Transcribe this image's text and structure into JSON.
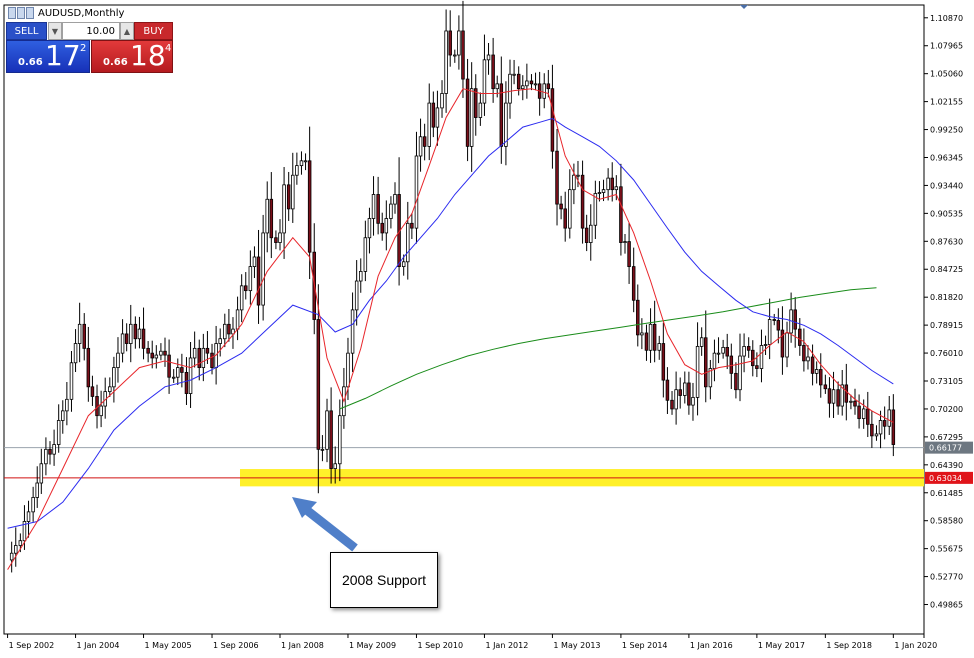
{
  "window": {
    "title": "AUDUSD,Monthly"
  },
  "trade_panel": {
    "sell_label": "SELL",
    "buy_label": "BUY",
    "lot_value": "10.00",
    "sell_price": {
      "prefix": "0.66",
      "big": "17",
      "sup": "2"
    },
    "buy_price": {
      "prefix": "0.66",
      "big": "18",
      "sup": "4"
    },
    "sell_color": "#2a50c8",
    "buy_color": "#c8282c"
  },
  "annotation": {
    "text": "2008 Support",
    "arrow_color": "#4f7fc9"
  },
  "chart_data": {
    "type": "candlestick",
    "symbol": "AUDUSD",
    "timeframe": "Monthly",
    "y_ticks": [
      "1.10870",
      "1.07965",
      "1.05060",
      "1.02155",
      "0.99250",
      "0.96345",
      "0.93440",
      "0.90535",
      "0.87630",
      "0.84725",
      "0.81820",
      "0.78915",
      "0.76010",
      "0.73105",
      "0.70200",
      "0.67295",
      "0.64390",
      "0.61485",
      "0.58580",
      "0.55675",
      "0.52770",
      "0.49865"
    ],
    "ylim": [
      0.468,
      1.122
    ],
    "x_ticks": [
      "1 Sep 2002",
      "1 Jan 2004",
      "1 May 2005",
      "1 Sep 2006",
      "1 Jan 2008",
      "1 May 2009",
      "1 Sep 2010",
      "1 Jan 2012",
      "1 May 2013",
      "1 Sep 2014",
      "1 Jan 2016",
      "1 May 2017",
      "1 Sep 2018",
      "1 Jan 2020"
    ],
    "xlim": [
      2002.6,
      2020.6
    ],
    "current_price_label": "0.66177",
    "current_price": 0.66177,
    "support_price_label": "0.63034",
    "support_price": 0.63034,
    "support_band": [
      0.6215,
      0.6395
    ],
    "colors": {
      "bull_candle": "#ffffff",
      "bear_candle": "#7a0f1a",
      "ma_fast": "#e8262b",
      "ma_mid": "#2b2bf0",
      "ma_slow": "#1a8c1a",
      "support_line": "#d01010",
      "support_band": "#fff02a",
      "price_line": "#9aa3ad"
    },
    "close_path": [
      [
        2002.67,
        0.545
      ],
      [
        2002.75,
        0.552
      ],
      [
        2002.83,
        0.56
      ],
      [
        2002.92,
        0.565
      ],
      [
        2003.0,
        0.585
      ],
      [
        2003.08,
        0.595
      ],
      [
        2003.17,
        0.61
      ],
      [
        2003.25,
        0.625
      ],
      [
        2003.33,
        0.645
      ],
      [
        2003.42,
        0.66
      ],
      [
        2003.5,
        0.655
      ],
      [
        2003.58,
        0.665
      ],
      [
        2003.67,
        0.69
      ],
      [
        2003.75,
        0.7
      ],
      [
        2003.83,
        0.712
      ],
      [
        2003.92,
        0.75
      ],
      [
        2004.0,
        0.77
      ],
      [
        2004.08,
        0.79
      ],
      [
        2004.17,
        0.765
      ],
      [
        2004.25,
        0.725
      ],
      [
        2004.33,
        0.715
      ],
      [
        2004.42,
        0.695
      ],
      [
        2004.5,
        0.705
      ],
      [
        2004.58,
        0.72
      ],
      [
        2004.67,
        0.725
      ],
      [
        2004.75,
        0.745
      ],
      [
        2004.83,
        0.76
      ],
      [
        2004.92,
        0.78
      ],
      [
        2005.0,
        0.77
      ],
      [
        2005.08,
        0.79
      ],
      [
        2005.17,
        0.775
      ],
      [
        2005.25,
        0.785
      ],
      [
        2005.33,
        0.765
      ],
      [
        2005.42,
        0.76
      ],
      [
        2005.5,
        0.755
      ],
      [
        2005.58,
        0.758
      ],
      [
        2005.67,
        0.762
      ],
      [
        2005.75,
        0.758
      ],
      [
        2005.83,
        0.735
      ],
      [
        2005.92,
        0.735
      ],
      [
        2006.0,
        0.745
      ],
      [
        2006.08,
        0.74
      ],
      [
        2006.17,
        0.718
      ],
      [
        2006.25,
        0.755
      ],
      [
        2006.33,
        0.765
      ],
      [
        2006.42,
        0.745
      ],
      [
        2006.5,
        0.765
      ],
      [
        2006.58,
        0.76
      ],
      [
        2006.67,
        0.745
      ],
      [
        2006.75,
        0.77
      ],
      [
        2006.83,
        0.775
      ],
      [
        2006.92,
        0.79
      ],
      [
        2007.0,
        0.78
      ],
      [
        2007.08,
        0.785
      ],
      [
        2007.17,
        0.805
      ],
      [
        2007.25,
        0.83
      ],
      [
        2007.33,
        0.825
      ],
      [
        2007.42,
        0.85
      ],
      [
        2007.5,
        0.86
      ],
      [
        2007.58,
        0.81
      ],
      [
        2007.67,
        0.885
      ],
      [
        2007.75,
        0.92
      ],
      [
        2007.83,
        0.88
      ],
      [
        2007.92,
        0.875
      ],
      [
        2008.0,
        0.885
      ],
      [
        2008.08,
        0.935
      ],
      [
        2008.17,
        0.91
      ],
      [
        2008.25,
        0.945
      ],
      [
        2008.33,
        0.955
      ],
      [
        2008.42,
        0.96
      ],
      [
        2008.5,
        0.96
      ],
      [
        2008.58,
        0.865
      ],
      [
        2008.67,
        0.795
      ],
      [
        2008.75,
        0.66
      ],
      [
        2008.83,
        0.66
      ],
      [
        2008.92,
        0.7
      ],
      [
        2009.0,
        0.64
      ],
      [
        2009.08,
        0.645
      ],
      [
        2009.17,
        0.695
      ],
      [
        2009.25,
        0.725
      ],
      [
        2009.33,
        0.76
      ],
      [
        2009.42,
        0.805
      ],
      [
        2009.5,
        0.835
      ],
      [
        2009.58,
        0.845
      ],
      [
        2009.67,
        0.88
      ],
      [
        2009.75,
        0.9
      ],
      [
        2009.83,
        0.925
      ],
      [
        2009.92,
        0.895
      ],
      [
        2010.0,
        0.885
      ],
      [
        2010.08,
        0.9
      ],
      [
        2010.17,
        0.915
      ],
      [
        2010.25,
        0.925
      ],
      [
        2010.33,
        0.85
      ],
      [
        2010.42,
        0.855
      ],
      [
        2010.5,
        0.895
      ],
      [
        2010.58,
        0.89
      ],
      [
        2010.67,
        0.965
      ],
      [
        2010.75,
        0.985
      ],
      [
        2010.83,
        0.975
      ],
      [
        2010.92,
        1.02
      ],
      [
        2011.0,
        0.995
      ],
      [
        2011.08,
        1.015
      ],
      [
        2011.17,
        1.03
      ],
      [
        2011.25,
        1.095
      ],
      [
        2011.33,
        1.07
      ],
      [
        2011.42,
        1.07
      ],
      [
        2011.5,
        1.095
      ],
      [
        2011.58,
        1.045
      ],
      [
        2011.67,
        0.975
      ],
      [
        2011.75,
        1.035
      ],
      [
        2011.83,
        1.005
      ],
      [
        2011.92,
        1.02
      ],
      [
        2012.0,
        1.065
      ],
      [
        2012.08,
        1.07
      ],
      [
        2012.17,
        1.035
      ],
      [
        2012.25,
        1.04
      ],
      [
        2012.33,
        0.975
      ],
      [
        2012.42,
        1.02
      ],
      [
        2012.5,
        1.05
      ],
      [
        2012.58,
        1.05
      ],
      [
        2012.67,
        1.035
      ],
      [
        2012.75,
        1.038
      ],
      [
        2012.83,
        1.043
      ],
      [
        2012.92,
        1.04
      ],
      [
        2013.0,
        1.04
      ],
      [
        2013.08,
        1.025
      ],
      [
        2013.17,
        1.04
      ],
      [
        2013.25,
        1.035
      ],
      [
        2013.33,
        0.97
      ],
      [
        2013.42,
        0.915
      ],
      [
        2013.5,
        0.91
      ],
      [
        2013.58,
        0.89
      ],
      [
        2013.67,
        0.93
      ],
      [
        2013.75,
        0.945
      ],
      [
        2013.83,
        0.945
      ],
      [
        2013.92,
        0.89
      ],
      [
        2014.0,
        0.875
      ],
      [
        2014.08,
        0.893
      ],
      [
        2014.17,
        0.926
      ],
      [
        2014.25,
        0.927
      ],
      [
        2014.33,
        0.93
      ],
      [
        2014.42,
        0.942
      ],
      [
        2014.5,
        0.93
      ],
      [
        2014.58,
        0.933
      ],
      [
        2014.67,
        0.875
      ],
      [
        2014.75,
        0.876
      ],
      [
        2014.83,
        0.85
      ],
      [
        2014.92,
        0.815
      ],
      [
        2015.0,
        0.779
      ],
      [
        2015.08,
        0.781
      ],
      [
        2015.17,
        0.763
      ],
      [
        2015.25,
        0.79
      ],
      [
        2015.33,
        0.763
      ],
      [
        2015.42,
        0.77
      ],
      [
        2015.5,
        0.732
      ],
      [
        2015.58,
        0.711
      ],
      [
        2015.67,
        0.702
      ],
      [
        2015.75,
        0.722
      ],
      [
        2015.83,
        0.716
      ],
      [
        2015.92,
        0.729
      ],
      [
        2016.0,
        0.706
      ],
      [
        2016.08,
        0.714
      ],
      [
        2016.17,
        0.767
      ],
      [
        2016.25,
        0.776
      ],
      [
        2016.33,
        0.725
      ],
      [
        2016.42,
        0.744
      ],
      [
        2016.5,
        0.76
      ],
      [
        2016.58,
        0.76
      ],
      [
        2016.67,
        0.766
      ],
      [
        2016.75,
        0.757
      ],
      [
        2016.83,
        0.739
      ],
      [
        2016.92,
        0.722
      ],
      [
        2017.0,
        0.757
      ],
      [
        2017.08,
        0.767
      ],
      [
        2017.17,
        0.763
      ],
      [
        2017.25,
        0.747
      ],
      [
        2017.33,
        0.744
      ],
      [
        2017.42,
        0.768
      ],
      [
        2017.5,
        0.769
      ],
      [
        2017.58,
        0.795
      ],
      [
        2017.67,
        0.794
      ],
      [
        2017.75,
        0.784
      ],
      [
        2017.83,
        0.756
      ],
      [
        2017.92,
        0.781
      ],
      [
        2018.0,
        0.805
      ],
      [
        2018.08,
        0.785
      ],
      [
        2018.17,
        0.768
      ],
      [
        2018.25,
        0.752
      ],
      [
        2018.33,
        0.756
      ],
      [
        2018.42,
        0.739
      ],
      [
        2018.5,
        0.743
      ],
      [
        2018.58,
        0.727
      ],
      [
        2018.67,
        0.723
      ],
      [
        2018.75,
        0.708
      ],
      [
        2018.83,
        0.722
      ],
      [
        2018.92,
        0.705
      ],
      [
        2019.0,
        0.727
      ],
      [
        2019.08,
        0.709
      ],
      [
        2019.17,
        0.71
      ],
      [
        2019.25,
        0.705
      ],
      [
        2019.33,
        0.692
      ],
      [
        2019.42,
        0.702
      ],
      [
        2019.5,
        0.686
      ],
      [
        2019.58,
        0.674
      ],
      [
        2019.67,
        0.676
      ],
      [
        2019.75,
        0.69
      ],
      [
        2019.83,
        0.684
      ],
      [
        2019.92,
        0.701
      ],
      [
        2020.0,
        0.665
      ]
    ],
    "ma_fast": [
      [
        2002.67,
        0.535
      ],
      [
        2003.25,
        0.585
      ],
      [
        2003.75,
        0.64
      ],
      [
        2004.25,
        0.695
      ],
      [
        2004.75,
        0.72
      ],
      [
        2005.25,
        0.745
      ],
      [
        2005.75,
        0.752
      ],
      [
        2006.25,
        0.745
      ],
      [
        2006.75,
        0.758
      ],
      [
        2007.25,
        0.79
      ],
      [
        2007.75,
        0.845
      ],
      [
        2008.25,
        0.88
      ],
      [
        2008.58,
        0.86
      ],
      [
        2008.92,
        0.755
      ],
      [
        2009.25,
        0.71
      ],
      [
        2009.58,
        0.765
      ],
      [
        2009.92,
        0.84
      ],
      [
        2010.25,
        0.88
      ],
      [
        2010.58,
        0.905
      ],
      [
        2010.92,
        0.955
      ],
      [
        2011.25,
        1.005
      ],
      [
        2011.58,
        1.035
      ],
      [
        2011.92,
        1.03
      ],
      [
        2012.25,
        1.03
      ],
      [
        2012.58,
        1.033
      ],
      [
        2012.92,
        1.035
      ],
      [
        2013.25,
        1.03
      ],
      [
        2013.58,
        0.965
      ],
      [
        2013.92,
        0.93
      ],
      [
        2014.25,
        0.92
      ],
      [
        2014.58,
        0.925
      ],
      [
        2014.92,
        0.885
      ],
      [
        2015.25,
        0.835
      ],
      [
        2015.58,
        0.78
      ],
      [
        2015.92,
        0.748
      ],
      [
        2016.25,
        0.738
      ],
      [
        2016.58,
        0.745
      ],
      [
        2016.92,
        0.748
      ],
      [
        2017.25,
        0.752
      ],
      [
        2017.58,
        0.768
      ],
      [
        2017.92,
        0.782
      ],
      [
        2018.25,
        0.772
      ],
      [
        2018.58,
        0.748
      ],
      [
        2018.92,
        0.728
      ],
      [
        2019.25,
        0.712
      ],
      [
        2019.58,
        0.7
      ],
      [
        2020.0,
        0.688
      ]
    ],
    "ma_mid": [
      [
        2002.67,
        0.578
      ],
      [
        2003.25,
        0.585
      ],
      [
        2003.75,
        0.605
      ],
      [
        2004.25,
        0.64
      ],
      [
        2004.75,
        0.68
      ],
      [
        2005.25,
        0.705
      ],
      [
        2005.75,
        0.725
      ],
      [
        2006.25,
        0.732
      ],
      [
        2006.75,
        0.745
      ],
      [
        2007.25,
        0.76
      ],
      [
        2007.75,
        0.785
      ],
      [
        2008.25,
        0.81
      ],
      [
        2008.75,
        0.8
      ],
      [
        2009.08,
        0.782
      ],
      [
        2009.42,
        0.79
      ],
      [
        2009.75,
        0.815
      ],
      [
        2010.08,
        0.835
      ],
      [
        2010.42,
        0.86
      ],
      [
        2010.75,
        0.88
      ],
      [
        2011.08,
        0.9
      ],
      [
        2011.42,
        0.925
      ],
      [
        2011.75,
        0.945
      ],
      [
        2012.08,
        0.965
      ],
      [
        2012.42,
        0.98
      ],
      [
        2012.75,
        0.995
      ],
      [
        2013.08,
        1.0
      ],
      [
        2013.33,
        1.004
      ],
      [
        2013.58,
        0.995
      ],
      [
        2013.92,
        0.985
      ],
      [
        2014.25,
        0.975
      ],
      [
        2014.58,
        0.96
      ],
      [
        2014.92,
        0.94
      ],
      [
        2015.25,
        0.915
      ],
      [
        2015.58,
        0.89
      ],
      [
        2015.92,
        0.865
      ],
      [
        2016.25,
        0.845
      ],
      [
        2016.58,
        0.83
      ],
      [
        2016.92,
        0.815
      ],
      [
        2017.25,
        0.803
      ],
      [
        2017.58,
        0.798
      ],
      [
        2017.92,
        0.795
      ],
      [
        2018.25,
        0.789
      ],
      [
        2018.58,
        0.78
      ],
      [
        2018.92,
        0.768
      ],
      [
        2019.25,
        0.755
      ],
      [
        2019.58,
        0.742
      ],
      [
        2020.0,
        0.728
      ]
    ],
    "ma_slow": [
      [
        2009.17,
        0.702
      ],
      [
        2009.67,
        0.713
      ],
      [
        2010.17,
        0.726
      ],
      [
        2010.67,
        0.738
      ],
      [
        2011.17,
        0.748
      ],
      [
        2011.67,
        0.757
      ],
      [
        2012.17,
        0.764
      ],
      [
        2012.67,
        0.77
      ],
      [
        2013.17,
        0.775
      ],
      [
        2013.67,
        0.779
      ],
      [
        2014.17,
        0.783
      ],
      [
        2014.67,
        0.787
      ],
      [
        2015.17,
        0.791
      ],
      [
        2015.67,
        0.795
      ],
      [
        2016.17,
        0.799
      ],
      [
        2016.67,
        0.803
      ],
      [
        2017.17,
        0.808
      ],
      [
        2017.67,
        0.813
      ],
      [
        2018.17,
        0.818
      ],
      [
        2018.67,
        0.822
      ],
      [
        2019.17,
        0.826
      ],
      [
        2019.67,
        0.828
      ]
    ]
  }
}
